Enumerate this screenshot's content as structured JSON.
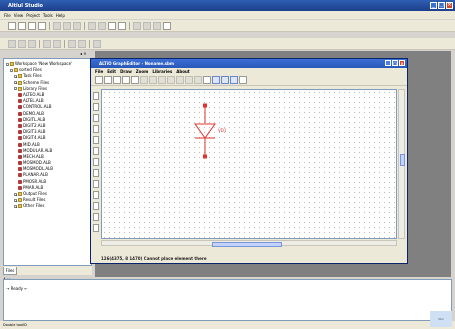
{
  "app": {
    "title": "Altiul Studio",
    "window_controls": [
      "_",
      "□",
      "×"
    ]
  },
  "menubar": [
    "File",
    "View",
    "Project",
    "Tools",
    "Help"
  ],
  "tree": {
    "items": [
      {
        "label": "Workspace 'New Workspace'",
        "icon": "workspace",
        "expander": "-"
      },
      {
        "label": "sorted Files",
        "icon": "folder",
        "expander": "-"
      },
      {
        "label": "Task Files",
        "icon": "folder",
        "expander": "+"
      },
      {
        "label": "Scheme Files",
        "icon": "folder",
        "expander": "+"
      },
      {
        "label": "Library Files",
        "icon": "folder",
        "expander": "-"
      },
      {
        "label": "ALTEO.ALB",
        "icon": "file"
      },
      {
        "label": "ALTEL.ALB",
        "icon": "file"
      },
      {
        "label": "CONTROL.ALB",
        "icon": "file"
      },
      {
        "label": "DEMO.ALB",
        "icon": "file"
      },
      {
        "label": "DIGITL.ALB",
        "icon": "file"
      },
      {
        "label": "DIGIT2.ALB",
        "icon": "file"
      },
      {
        "label": "DIGIT3.ALB",
        "icon": "file"
      },
      {
        "label": "DIGIT4.ALB",
        "icon": "file"
      },
      {
        "label": "MID.ALB",
        "icon": "file"
      },
      {
        "label": "MODULAR.ALB",
        "icon": "file"
      },
      {
        "label": "MECH.ALB",
        "icon": "file"
      },
      {
        "label": "MOSMOD.ALB",
        "icon": "file"
      },
      {
        "label": "MOSMODL.ALB",
        "icon": "file"
      },
      {
        "label": "PLANAR.ALB",
        "icon": "file"
      },
      {
        "label": "PMOSR.ALB",
        "icon": "file"
      },
      {
        "label": "PMAR.ALB",
        "icon": "file"
      },
      {
        "label": "Output Files",
        "icon": "folder",
        "expander": "+"
      },
      {
        "label": "Result Files",
        "icon": "folder",
        "expander": "+"
      },
      {
        "label": "Other Files",
        "icon": "folder",
        "expander": "+"
      }
    ],
    "pane_controls": "◂ ×",
    "tab_label": "Files"
  },
  "child": {
    "title": "ALTiO GraphEditor - Noname.sbm",
    "menu": [
      "File",
      "Edit",
      "Draw",
      "Zoom",
      "Libraries",
      "About"
    ],
    "status": "126(4375, 8 1470) Cannot place element there"
  },
  "diode": {
    "label": "VD1",
    "color": "#e0342e"
  },
  "output": {
    "header": "4 ×",
    "line": "→ Ready ←"
  },
  "statusbar": {
    "text": "Double toolID"
  },
  "corner": {
    "text": "Vbx"
  }
}
